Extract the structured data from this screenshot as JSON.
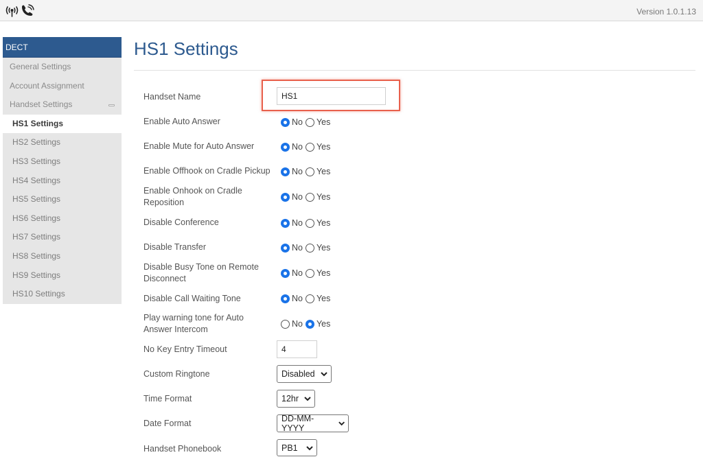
{
  "header": {
    "version": "Version 1.0.1.13",
    "logo_icon": "antenna-phone-icon"
  },
  "sidebar": {
    "section": "DECT",
    "items": [
      {
        "label": "General Settings"
      },
      {
        "label": "Account Assignment"
      },
      {
        "label": "Handset Settings",
        "collapse_icon": "minus-icon"
      },
      {
        "label": "HS1 Settings",
        "active": true
      },
      {
        "label": "HS2 Settings"
      },
      {
        "label": "HS3 Settings"
      },
      {
        "label": "HS4 Settings"
      },
      {
        "label": "HS5 Settings"
      },
      {
        "label": "HS6 Settings"
      },
      {
        "label": "HS7 Settings"
      },
      {
        "label": "HS8 Settings"
      },
      {
        "label": "HS9 Settings"
      },
      {
        "label": "HS10 Settings"
      }
    ]
  },
  "page": {
    "title": "HS1 Settings"
  },
  "options": {
    "no": "No",
    "yes": "Yes"
  },
  "form": {
    "handset_name": {
      "label": "Handset Name",
      "value": "HS1"
    },
    "enable_auto_answer": {
      "label": "Enable Auto Answer",
      "selected": "No"
    },
    "enable_mute_auto_answer": {
      "label": "Enable Mute for Auto Answer",
      "selected": "No"
    },
    "enable_offhook_cradle": {
      "label": "Enable Offhook on Cradle Pickup",
      "selected": "No"
    },
    "enable_onhook_cradle": {
      "label": "Enable Onhook on Cradle Reposition",
      "selected": "No"
    },
    "disable_conference": {
      "label": "Disable Conference",
      "selected": "No"
    },
    "disable_transfer": {
      "label": "Disable Transfer",
      "selected": "No"
    },
    "disable_busy_tone": {
      "label": "Disable Busy Tone on Remote Disconnect",
      "selected": "No"
    },
    "disable_call_waiting_tone": {
      "label": "Disable Call Waiting Tone",
      "selected": "No"
    },
    "play_warning_tone": {
      "label": "Play warning tone for Auto Answer Intercom",
      "selected": "Yes"
    },
    "no_key_entry_timeout": {
      "label": "No Key Entry Timeout",
      "value": "4"
    },
    "custom_ringtone": {
      "label": "Custom Ringtone",
      "value": "Disabled"
    },
    "time_format": {
      "label": "Time Format",
      "value": "12hr"
    },
    "date_format": {
      "label": "Date Format",
      "value": "DD-MM-YYYY"
    },
    "handset_phonebook": {
      "label": "Handset Phonebook",
      "value": "PB1"
    }
  },
  "colors": {
    "accent": "#2d5a8f",
    "highlight": "#e8604c",
    "radio_selected": "#1a73e8"
  }
}
